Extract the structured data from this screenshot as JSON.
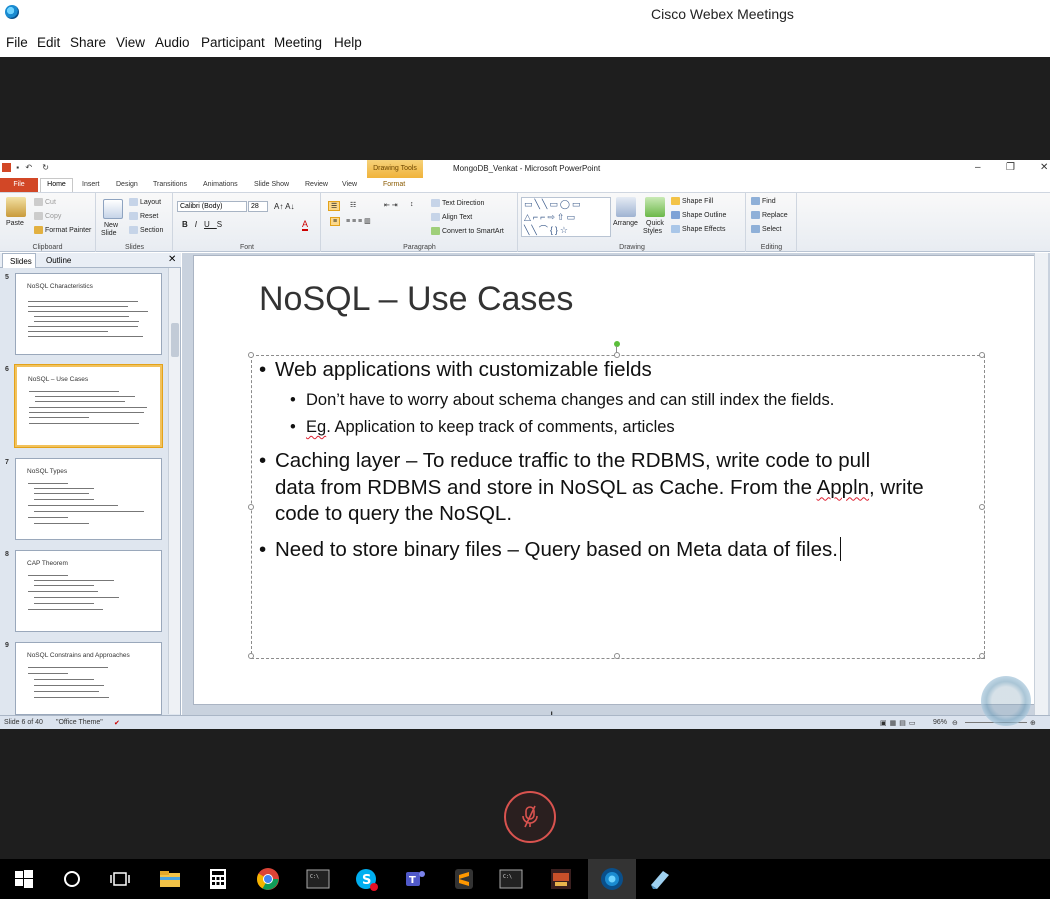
{
  "webex": {
    "window_title": "Cisco Webex Meetings",
    "menu": [
      "File",
      "Edit",
      "Share",
      "View",
      "Audio",
      "Participant",
      "Meeting",
      "Help"
    ]
  },
  "powerpoint": {
    "window_title": "MongoDB_Venkat - Microsoft PowerPoint",
    "contextual_tab_group": "Drawing Tools",
    "tabs": [
      "File",
      "Home",
      "Insert",
      "Design",
      "Transitions",
      "Animations",
      "Slide Show",
      "Review",
      "View",
      "Format"
    ],
    "ribbon": {
      "clipboard": {
        "name": "Clipboard",
        "paste": "Paste",
        "cut": "Cut",
        "copy": "Copy",
        "format_painter": "Format Painter"
      },
      "slides": {
        "name": "Slides",
        "new_slide_line1": "New",
        "new_slide_line2": "Slide",
        "layout": "Layout",
        "reset": "Reset",
        "section": "Section"
      },
      "font": {
        "name": "Font",
        "face": "Calibri (Body)",
        "size": "28"
      },
      "paragraph": {
        "name": "Paragraph",
        "text_direction": "Text Direction",
        "align_text": "Align Text",
        "convert_smartart": "Convert to SmartArt"
      },
      "drawing": {
        "name": "Drawing",
        "arrange": "Arrange",
        "quick_styles_line1": "Quick",
        "quick_styles_line2": "Styles",
        "shape_fill": "Shape Fill",
        "shape_outline": "Shape Outline",
        "shape_effects": "Shape Effects"
      },
      "editing": {
        "name": "Editing",
        "find": "Find",
        "replace": "Replace",
        "select": "Select"
      }
    },
    "pane_tabs": [
      "Slides",
      "Outline"
    ],
    "thumbnails": [
      {
        "num": "5",
        "title": "NoSQL Characteristics"
      },
      {
        "num": "6",
        "title": "NoSQL – Use Cases"
      },
      {
        "num": "7",
        "title": "NoSQL Types"
      },
      {
        "num": "8",
        "title": "CAP Theorem"
      },
      {
        "num": "9",
        "title": "NoSQL Constrains and Approaches"
      }
    ],
    "slide": {
      "title": "NoSQL – Use Cases",
      "bullet1": "Web applications with customizable fields",
      "sub1": "Don’t have to worry about schema changes and can still index the fields.",
      "sub2_prefix": "",
      "sub2_squiggle": "Eg",
      "sub2_rest": ". Application to keep track of comments, articles",
      "bullet2_line1": "Caching layer – To reduce traffic to the RDBMS, write code to pull",
      "bullet2_line2_a": "data from RDBMS and store in NoSQL as Cache. From the ",
      "bullet2_line2_squiggle": "Appln",
      "bullet2_line2_b": ", write",
      "bullet2_line3": "code to query the NoSQL.",
      "bullet3": "Need to store binary files – Query based on Meta data of files."
    },
    "status": {
      "slide_info": "Slide 6 of 40",
      "theme": "\"Office Theme\"",
      "zoom": "96%"
    }
  }
}
